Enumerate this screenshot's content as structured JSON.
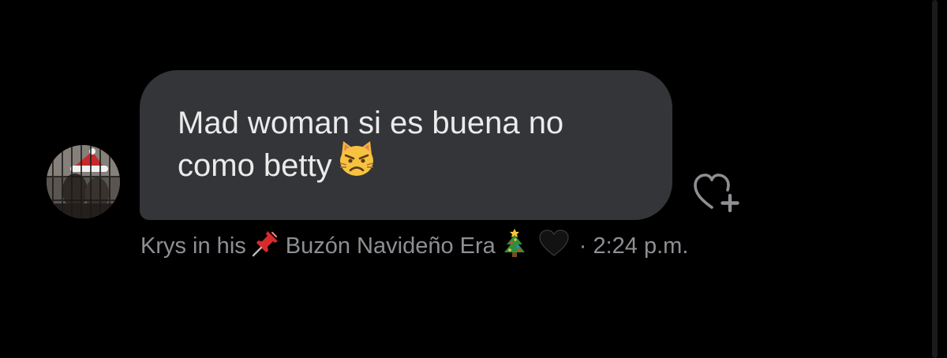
{
  "message": {
    "line1": "Mad woman si es buena no",
    "line2": "como betty",
    "emoji": "cat-pouting-face-icon"
  },
  "meta": {
    "sender_name_part1": "Krys in his",
    "sender_name_part2": "Buzón Navideño Era",
    "sender_name_emojis": [
      "pushpin-icon",
      "christmas-tree-icon",
      "black-heart-icon"
    ],
    "time": "· 2:24 p.m."
  },
  "actions": {
    "react_icon": "heart-plus-icon"
  },
  "colors": {
    "background": "#000000",
    "bubble": "#333538",
    "message_text": "#ebebeb",
    "meta_text": "#8d8f93"
  }
}
